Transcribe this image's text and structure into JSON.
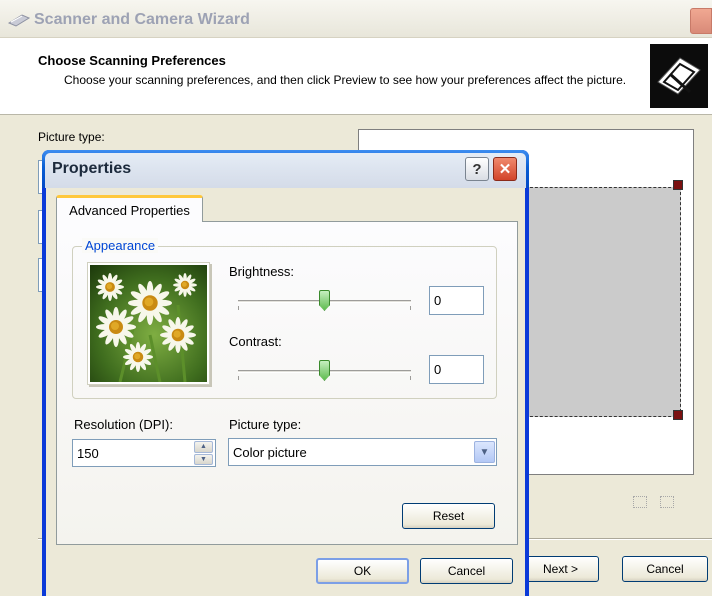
{
  "wizard": {
    "title": "Scanner and Camera Wizard",
    "header_title": "Choose Scanning Preferences",
    "header_subtitle": "Choose your scanning preferences, and then click Preview to see how your preferences affect the picture.",
    "picture_type_label": "Picture type:",
    "next_label": "Next >",
    "cancel_label": "Cancel"
  },
  "dialog": {
    "title": "Properties",
    "help_glyph": "?",
    "close_glyph": "✕",
    "tab_label": "Advanced Properties",
    "appearance_label": "Appearance",
    "brightness_label": "Brightness:",
    "brightness_value": "0",
    "brightness_level": 0.5,
    "contrast_label": "Contrast:",
    "contrast_value": "0",
    "contrast_level": 0.5,
    "resolution_label": "Resolution (DPI):",
    "resolution_value": "150",
    "picture_type_label": "Picture type:",
    "picture_type_value": "Color picture",
    "reset_label": "Reset",
    "ok_label": "OK",
    "cancel_label": "Cancel"
  },
  "icons": {
    "wizard": "scanner-icon",
    "preview_zoom": "zoom-to-selection-icon",
    "preview_fit": "fit-icon",
    "photo": "daisy-photo-icon"
  },
  "colors": {
    "dialog_frame": "#0b3ad8",
    "group_label": "#0046d5",
    "tab_accent": "#ffc83c",
    "slider_thumb": "#5fbb4f",
    "selection_handle": "#7a1010"
  }
}
